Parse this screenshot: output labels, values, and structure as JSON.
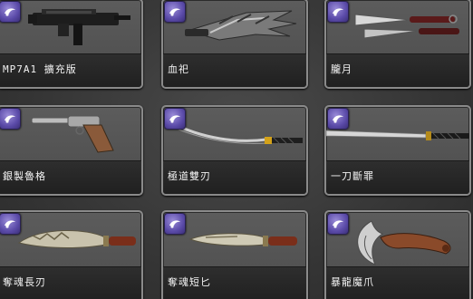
{
  "items": [
    {
      "name": "MP7A1 擴充版",
      "icon": "mp7a1-smg-icon"
    },
    {
      "name": "血祀",
      "icon": "blood-ritual-blade-icon"
    },
    {
      "name": "朧月",
      "icon": "hazy-moon-kunai-icon"
    },
    {
      "name": "銀製魯格",
      "icon": "silver-luger-pistol-icon"
    },
    {
      "name": "極道雙刃",
      "icon": "yakuza-twin-blade-icon"
    },
    {
      "name": "一刀斷罪",
      "icon": "katana-icon"
    },
    {
      "name": "奪魂長刃",
      "icon": "soul-reaper-long-blade-icon"
    },
    {
      "name": "奪魂短匕",
      "icon": "soul-reaper-dagger-icon"
    },
    {
      "name": "暴龍魔爪",
      "icon": "tyrant-dragon-claw-icon"
    }
  ],
  "badge_icon": "item-category-badge-icon",
  "colors": {
    "badge": "#5a4aa8",
    "card_border": "#8a8a8a",
    "label_bar": "#242424",
    "label_text": "#f2f2f2"
  }
}
